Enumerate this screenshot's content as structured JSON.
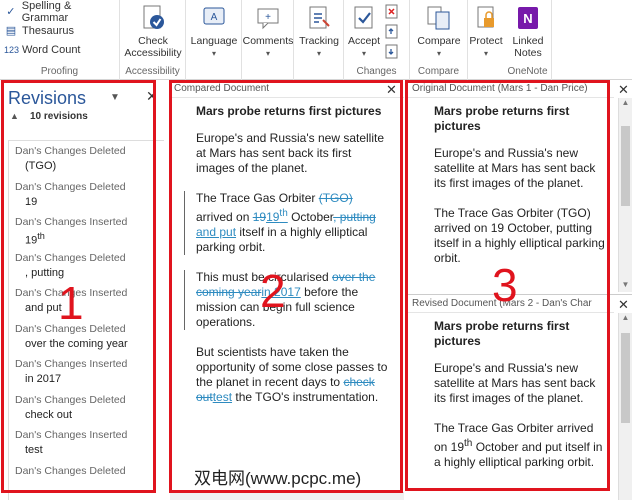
{
  "ribbon": {
    "proofing": {
      "items": [
        "Spelling & Grammar",
        "Thesaurus",
        "Word Count"
      ],
      "label": "Proofing"
    },
    "accessibility": {
      "button": "Check Accessibility",
      "label": "Accessibility"
    },
    "language": {
      "button": "Language"
    },
    "comments": {
      "button": "Comments"
    },
    "tracking": {
      "button": "Tracking"
    },
    "changes": {
      "button": "Accept",
      "label": "Changes"
    },
    "compare": {
      "button": "Compare",
      "label": "Compare"
    },
    "protect": {
      "button": "Protect"
    },
    "onenote": {
      "button": "Linked Notes",
      "label": "OneNote"
    }
  },
  "revisions": {
    "title": "Revisions",
    "count": "10 revisions",
    "items": [
      {
        "author": "Dan's Changes Deleted",
        "text": "(TGO)"
      },
      {
        "author": "Dan's Changes Deleted",
        "text": "19"
      },
      {
        "author": "Dan's Changes Inserted",
        "text": "19",
        "sup": "th"
      },
      {
        "author": "Dan's Changes Deleted",
        "text": ", putting"
      },
      {
        "author": "Dan's Changes Inserted",
        "text": "and put"
      },
      {
        "author": "Dan's Changes Deleted",
        "text": "over the coming year"
      },
      {
        "author": "Dan's Changes Inserted",
        "text": "in 2017"
      },
      {
        "author": "Dan's Changes Deleted",
        "text": "check out"
      },
      {
        "author": "Dan's Changes Inserted",
        "text": "test"
      },
      {
        "author": "Dan's Changes Deleted",
        "text": ""
      }
    ]
  },
  "compared": {
    "header": "Compared Document",
    "title": "Mars probe returns first pictures",
    "p1": "Europe's and Russia's new satellite at Mars has sent back its first images of the planet.",
    "p2": {
      "a": "The Trace Gas Orbiter ",
      "del1": "(TGO)",
      "b": " arrived on ",
      "del2": "19",
      "ins1": "19",
      "ins1_sup": "th",
      "c": " October",
      "del3": ", putting",
      "ins2": " and put",
      "d": " itself in a highly elliptical parking orbit."
    },
    "p3": {
      "a": "This must be circularised ",
      "del1": "over the coming year",
      "ins1": "in 2017",
      "b": " before the mission can begin full science operations."
    },
    "p4": {
      "a": "But scientists have taken the opportunity of some close passes to the planet in recent days to ",
      "del1": "check out",
      "ins1": "test",
      "b": " the TGO's instrumentation."
    }
  },
  "original": {
    "header": "Original Document (Mars 1 - Dan Price)",
    "title": "Mars probe returns first pictures",
    "p1": "Europe's and Russia's new satellite at Mars has sent back its first images of the planet.",
    "p2": "The Trace Gas Orbiter (TGO) arrived on 19 October, putting itself in a highly elliptical parking orbit."
  },
  "revised": {
    "header": "Revised Document (Mars 2 - Dan's Char",
    "title": "Mars probe returns first pictures",
    "p1": "Europe's and Russia's new satellite at Mars has sent back its first images of the planet.",
    "p2a": "The Trace Gas Orbiter arrived on 19",
    "p2sup": "th",
    "p2b": " October and put itself in a highly elliptical parking orbit."
  },
  "annotations": {
    "one": "1",
    "two": "2",
    "three": "3"
  },
  "watermark": "双电网(www.pcpc.me)",
  "colors": {
    "frame": "#e0141e",
    "revision": "#2e8bc0",
    "title": "#2b579a"
  }
}
